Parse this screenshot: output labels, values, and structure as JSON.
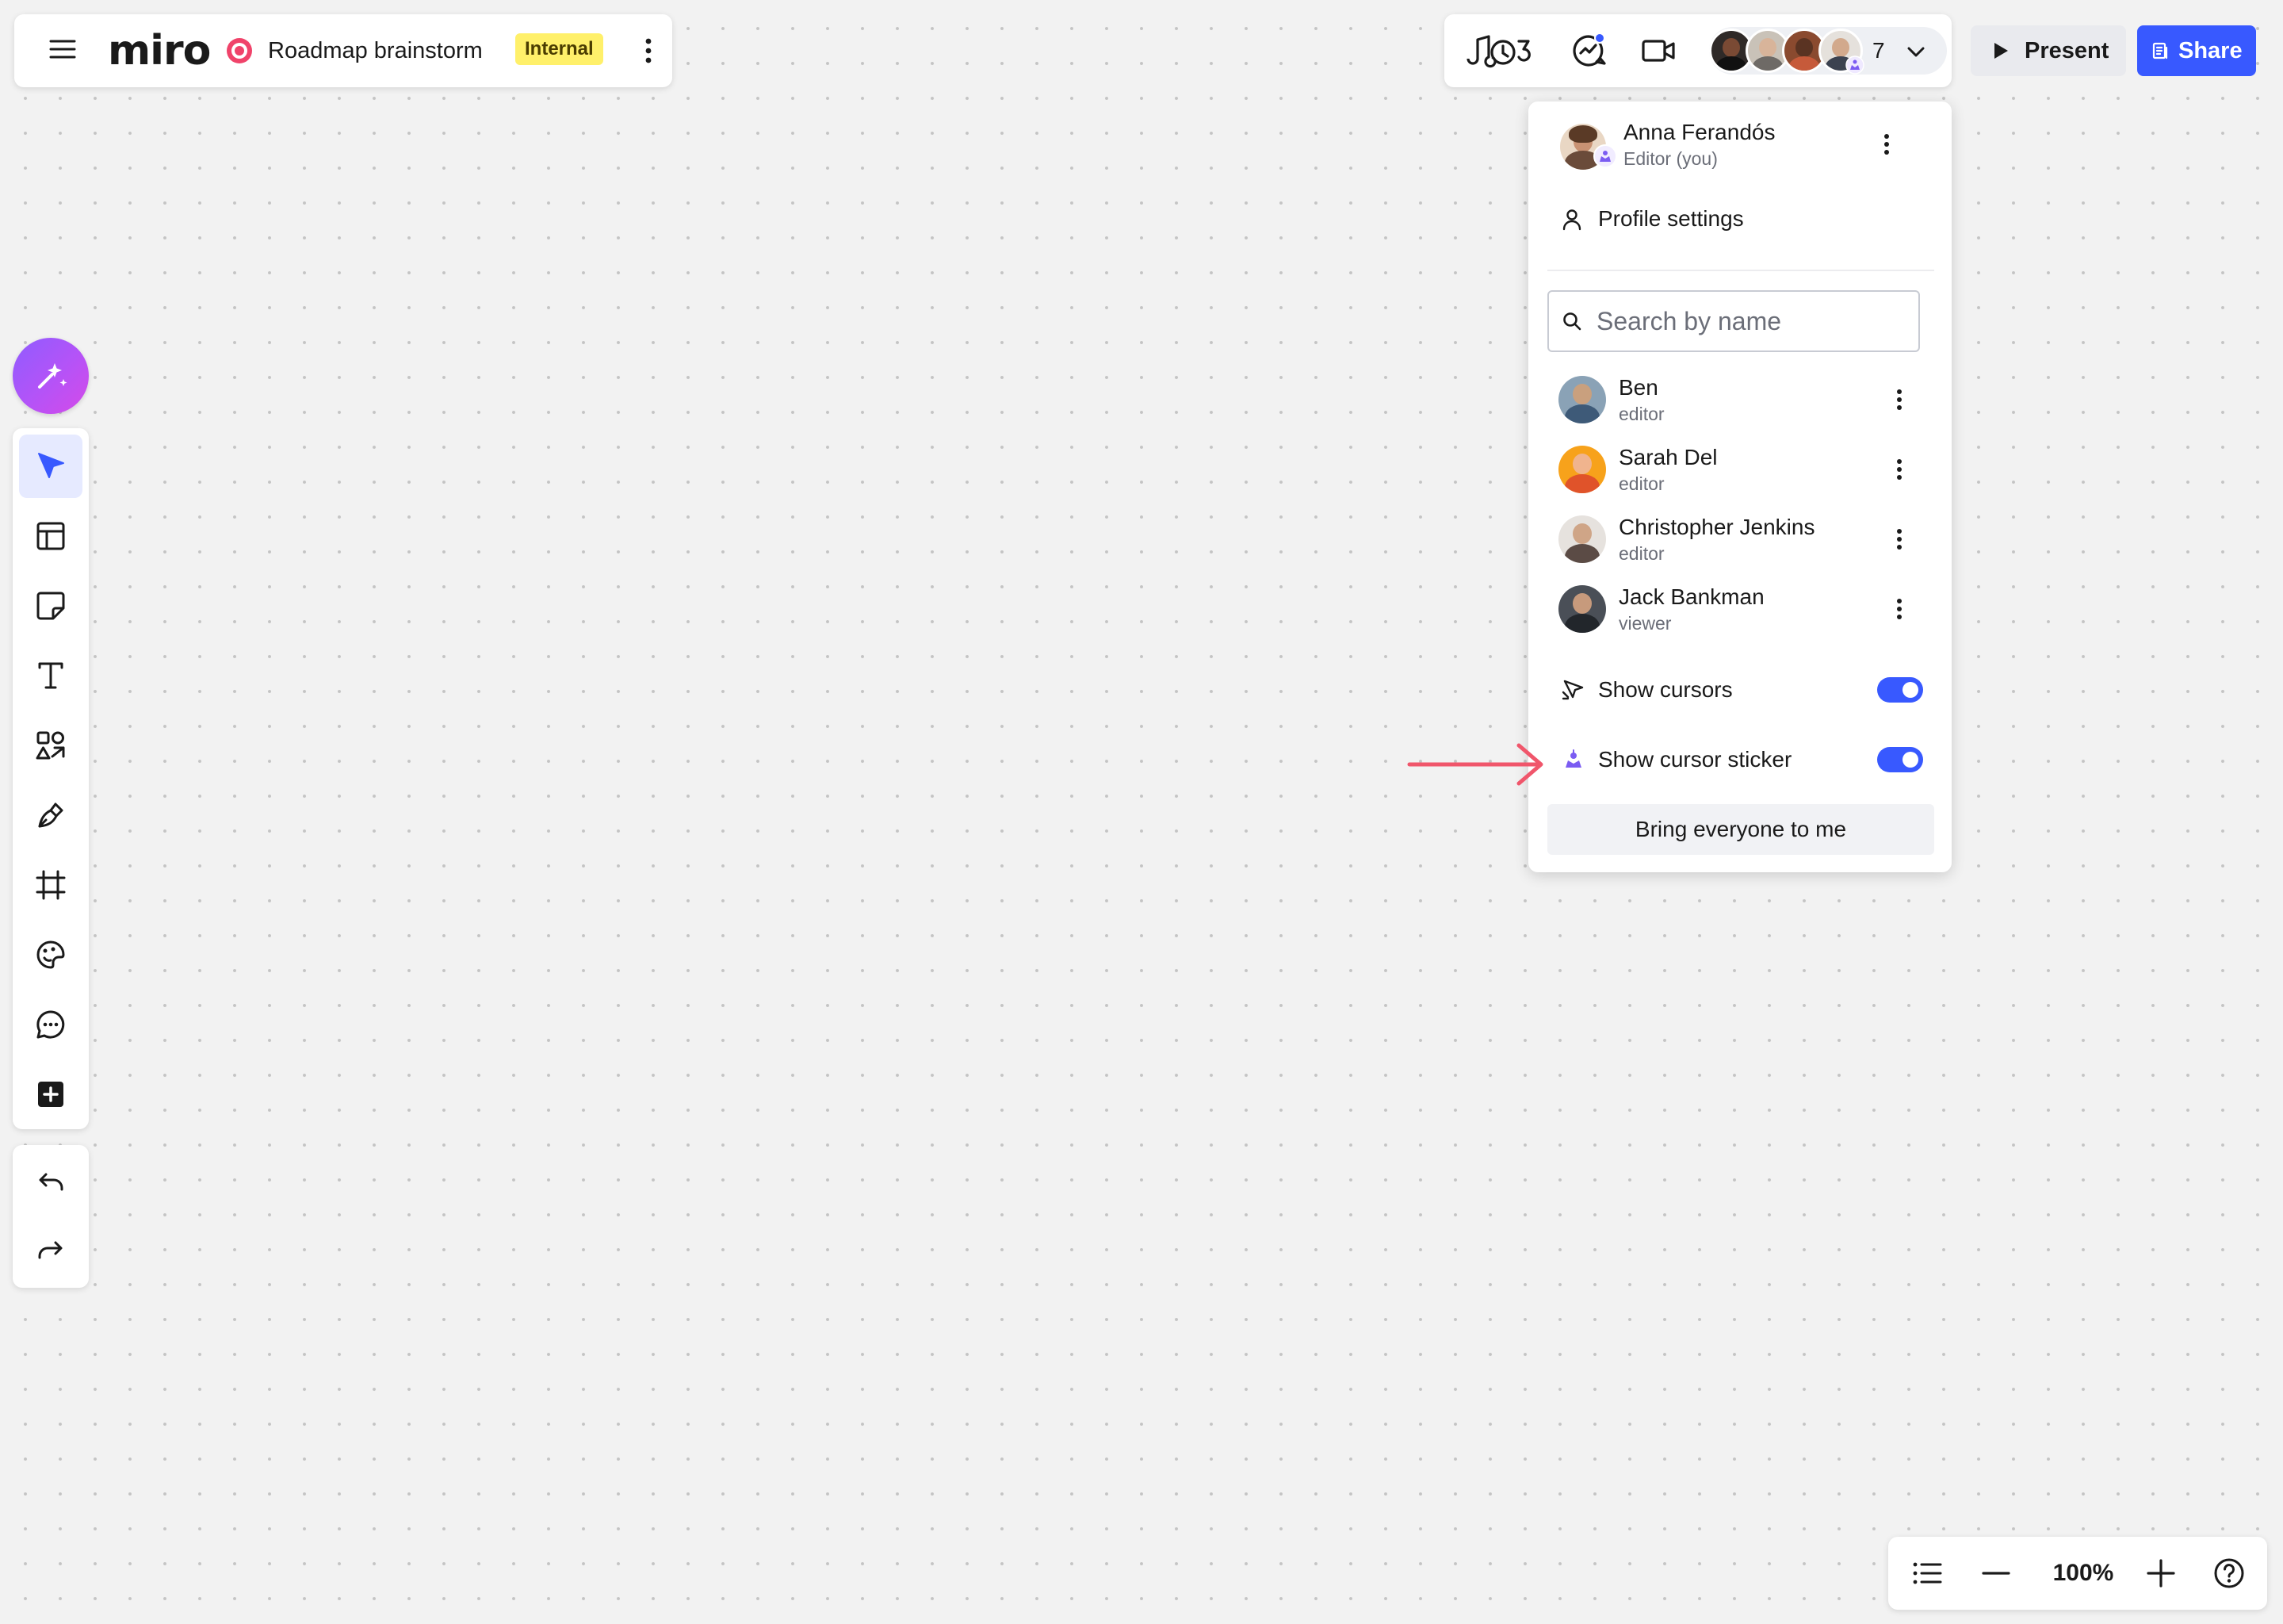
{
  "board": {
    "logo": "miro",
    "title": "Roadmap brainstorm",
    "badge": "Internal"
  },
  "collaborators": {
    "count": "7"
  },
  "buttons": {
    "present": "Present",
    "share": "Share"
  },
  "current_user": {
    "name": "Anna Ferandós",
    "role": "Editor (you)",
    "profile_settings": "Profile settings"
  },
  "search": {
    "placeholder": "Search by name"
  },
  "people": [
    {
      "name": "Ben",
      "role": "editor"
    },
    {
      "name": "Sarah Del",
      "role": "editor"
    },
    {
      "name": "Christopher Jenkins",
      "role": "editor"
    },
    {
      "name": "Jack Bankman",
      "role": "viewer"
    }
  ],
  "options": {
    "show_cursors": {
      "label": "Show cursors",
      "enabled": true
    },
    "show_cursor_sticker": {
      "label": "Show cursor sticker",
      "enabled": true
    },
    "bring_everyone": "Bring everyone to me"
  },
  "zoom": {
    "level": "100%"
  },
  "colors": {
    "accent": "#3859ff",
    "badge": "#fff06a",
    "annotation_arrow": "#f0566b",
    "ai_gradient_start": "#8f5cff",
    "ai_gradient_end": "#d54ae8"
  },
  "icons": {
    "board_menu": "hamburger-icon",
    "board_type": "target-icon",
    "timer": "timer-icon",
    "reactions": "reactions-icon",
    "video": "video-camera-icon",
    "ai": "sparkle-icon",
    "tools": [
      "cursor-arrow-icon",
      "templates-icon",
      "sticky-note-icon",
      "text-icon",
      "shapes-icon",
      "pen-icon",
      "frame-icon",
      "sticker-icon",
      "comment-icon",
      "add-more-icon"
    ],
    "undo": "undo-icon",
    "redo": "redo-icon"
  }
}
